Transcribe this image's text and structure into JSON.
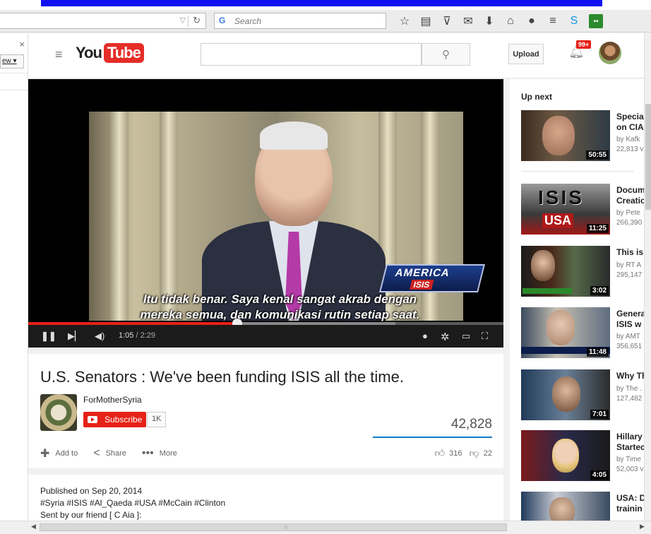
{
  "browser": {
    "search_placeholder": "Search",
    "icons": [
      "star-icon",
      "reading-list-icon",
      "pocket-icon",
      "mail-icon",
      "download-icon",
      "home-icon",
      "chat-icon",
      "menu-icon",
      "skype-icon",
      "extension-icon"
    ]
  },
  "masthead": {
    "logo_you": "You",
    "logo_tube": "Tube",
    "upload_label": "Upload",
    "notification_count": "99+"
  },
  "player": {
    "subtitle_line1": "Itu tidak benar. Saya kenal sangat akrab dengan",
    "subtitle_line2": "mereka semua, dan komunikasi rutin setiap saat.",
    "badge_line1": "AMERICA",
    "badge_line2": "ISIS",
    "current_time": "1:05",
    "duration": "/ 2:29",
    "progress_fraction": 0.44
  },
  "video": {
    "title": "U.S. Senators : We've been funding ISIS all the time.",
    "channel": "ForMotherSyria",
    "subscribe_label": "Subscribe",
    "subscriber_count": "1K",
    "views": "42,828",
    "add_to": "Add to",
    "share": "Share",
    "more": "More",
    "likes": "316",
    "dislikes": "22"
  },
  "description": {
    "published": "Published on Sep 20, 2014",
    "tags": "#Syria #ISIS #Al_Qaeda #USA #McCain #Clinton",
    "line3": "Sent by our friend [ C Aia ]:"
  },
  "up_next": {
    "heading": "Up next",
    "items": [
      {
        "title1": "Specia",
        "title2": "on CIA",
        "by": "by Kafk",
        "views": "22,813 v",
        "duration": "50:55"
      },
      {
        "title1": "Docum",
        "title2": "Creatio",
        "by": "by Pete",
        "views": "266,390",
        "duration": "11:25"
      },
      {
        "title1": "This is",
        "title2": "",
        "by": "by RT A",
        "views": "295,147",
        "duration": "3:02"
      },
      {
        "title1": "Genera",
        "title2": "ISIS w",
        "by": "by AMT",
        "views": "356,651",
        "duration": "11:48"
      },
      {
        "title1": "Why Th",
        "title2": "",
        "by": "by The .",
        "views": "127,482",
        "duration": "7:01"
      },
      {
        "title1": "Hillary",
        "title2": "Startec",
        "by": "by Time",
        "views": "52,003 v",
        "duration": "4:05"
      },
      {
        "title1": "USA: D",
        "title2": "trainin",
        "by": "",
        "views": "",
        "duration": ""
      }
    ]
  }
}
